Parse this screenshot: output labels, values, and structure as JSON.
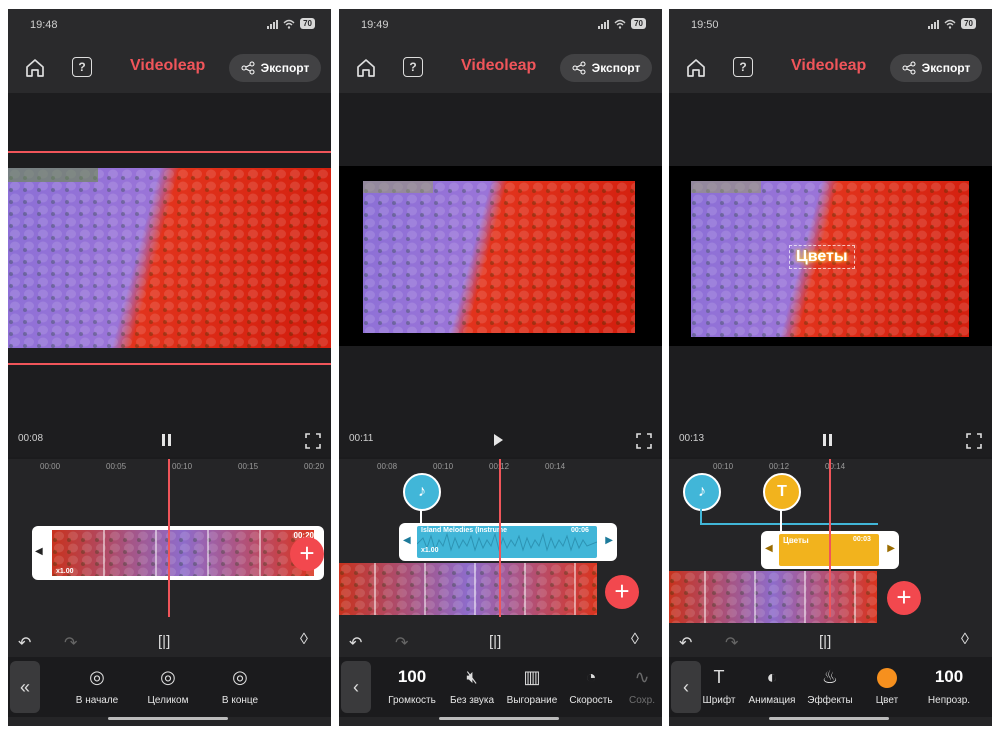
{
  "app": {
    "brand": "Videoleap",
    "export_label": "Экспорт"
  },
  "screens": [
    {
      "status_time": "19:48",
      "battery": "70",
      "time_current": "00:08",
      "playback_state": "pause",
      "ruler": [
        "00:00",
        "00:05",
        "00:10",
        "00:15",
        "00:20"
      ],
      "clip": {
        "speed": "x1.00",
        "duration": "00:20"
      },
      "tools": [
        {
          "icon": "align-start-icon",
          "label": "В начале"
        },
        {
          "icon": "align-full-icon",
          "label": "Целиком"
        },
        {
          "icon": "align-end-icon",
          "label": "В конце"
        }
      ]
    },
    {
      "status_time": "19:49",
      "battery": "70",
      "time_current": "00:11",
      "playback_state": "play",
      "ruler": [
        "00:08",
        "00:10",
        "00:12",
        "00:14"
      ],
      "audio_clip": {
        "title": "Island Melodies (Instrume",
        "duration": "00:06",
        "speed": "x1.00"
      },
      "tools": [
        {
          "value": "100",
          "label": "Громкость"
        },
        {
          "icon": "mute-icon",
          "label": "Без звука"
        },
        {
          "icon": "fade-icon",
          "label": "Выгорание"
        },
        {
          "icon": "speed-icon",
          "label": "Скорость"
        },
        {
          "icon": "save-icon",
          "label": "Сохр."
        }
      ]
    },
    {
      "status_time": "19:50",
      "battery": "70",
      "time_current": "00:13",
      "playback_state": "pause",
      "ruler": [
        "00:10",
        "00:12",
        "00:14"
      ],
      "overlay_text": "Цветы",
      "text_clip": {
        "title": "Цветы",
        "duration": "00:03"
      },
      "tools": [
        {
          "icon": "text-icon",
          "label": "Шрифт"
        },
        {
          "icon": "animation-icon",
          "label": "Анимация"
        },
        {
          "icon": "effects-icon",
          "label": "Эффекты"
        },
        {
          "icon": "color-icon",
          "label": "Цвет"
        },
        {
          "value": "100",
          "label": "Непрозр."
        }
      ]
    }
  ],
  "colors": {
    "accent": "#f0555a",
    "audio": "#41b6d8",
    "text_track": "#f2b31d",
    "background": "#1b1b1d"
  }
}
